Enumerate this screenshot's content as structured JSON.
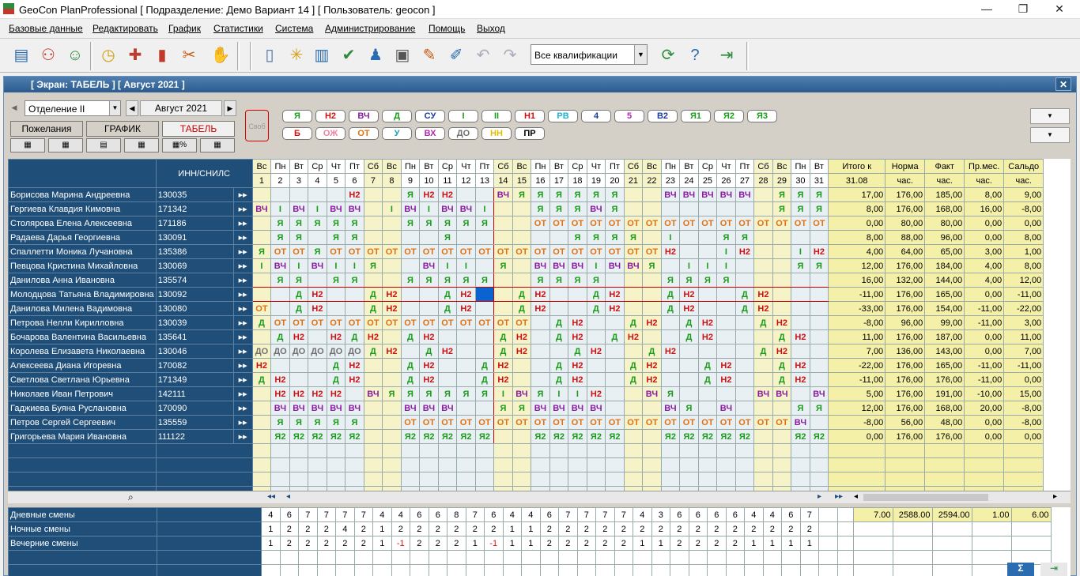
{
  "window": {
    "title": "GeoCon PlanProfessional [ Подразделение: Демо Вариант 14 ] [ Пользователь: geocon ]",
    "min": "—",
    "max": "❐",
    "close": "✕"
  },
  "menu": [
    "Базовые данные",
    "Редактировать",
    "График",
    "Статистики",
    "Система",
    "Администрирование",
    "Помощь",
    "Выход"
  ],
  "toolbar": {
    "qualification": "Все квалификации",
    "icons": [
      "staff-icon",
      "team-icon",
      "user-add-icon",
      "clock-icon",
      "calendar-add-icon",
      "chart-icon",
      "tools-icon",
      "hand-icon",
      "document-icon",
      "wand-icon",
      "trash-icon",
      "check-icon",
      "person-icon",
      "print-icon",
      "wrench-icon",
      "brush-icon",
      "undo-icon",
      "redo-icon",
      "refresh-icon",
      "help-icon",
      "exit-icon"
    ]
  },
  "screen": {
    "title": "[ Экран: ТАБЕЛЬ ] [ Август 2021 ]",
    "close": "✕"
  },
  "filters": {
    "department": "Отделение II",
    "month": "Август 2021"
  },
  "tabs": [
    "Пожелания",
    "ГРАФИК",
    "ТАБЕЛЬ"
  ],
  "legend": {
    "free": "Своб",
    "codes": [
      {
        "c": "Я",
        "col": "#1a9c1a"
      },
      {
        "c": "Н2",
        "col": "#d01010"
      },
      {
        "c": "ВЧ",
        "col": "#8a1aa0"
      },
      {
        "c": "Д",
        "col": "#1a9c1a"
      },
      {
        "c": "СУ",
        "col": "#1a3aa0"
      },
      {
        "c": "I",
        "col": "#1a9c1a"
      },
      {
        "c": "II",
        "col": "#1a9c1a"
      },
      {
        "c": "Н1",
        "col": "#d01010"
      },
      {
        "c": "РВ",
        "col": "#20b0d0"
      },
      {
        "c": "4",
        "col": "#1a3aa0"
      },
      {
        "c": "5",
        "col": "#b02ab0"
      },
      {
        "c": "В2",
        "col": "#1a3aa0"
      },
      {
        "c": "Я1",
        "col": "#1a9c1a"
      },
      {
        "c": "Я2",
        "col": "#1a9c1a"
      },
      {
        "c": "Я3",
        "col": "#1a9c1a"
      },
      {
        "c": "Б",
        "col": "#d01010"
      },
      {
        "c": "ОЖ",
        "col": "#f080a0"
      },
      {
        "c": "ОТ",
        "col": "#e07010"
      },
      {
        "c": "У",
        "col": "#20a0b0"
      },
      {
        "c": "ВХ",
        "col": "#b02ab0"
      },
      {
        "c": "ДО",
        "col": "#707070"
      },
      {
        "c": "НН",
        "col": "#e0c000"
      },
      {
        "c": "ПР",
        "col": "#000000"
      }
    ]
  },
  "colors": {
    "Я": "#1a9c1a",
    "Я2": "#1a9c1a",
    "Н2": "#d01010",
    "ВЧ": "#8a1aa0",
    "Д": "#1a9c1a",
    "I": "#1a9c1a",
    "ОТ": "#e07010",
    "ДО": "#707070"
  },
  "header": {
    "inn": "ИНН/СНИЛС",
    "weekdays": [
      "Вс",
      "Пн",
      "Вт",
      "Ср",
      "Чт",
      "Пт",
      "Сб",
      "Вс",
      "Пн",
      "Вт",
      "Ср",
      "Чт",
      "Пт",
      "Сб",
      "Вс",
      "Пн",
      "Вт",
      "Ср",
      "Чт",
      "Пт",
      "Сб",
      "Вс",
      "Пн",
      "Вт",
      "Ср",
      "Чт",
      "Пт",
      "Сб",
      "Вс",
      "Пн",
      "Вт"
    ],
    "sum_titles": [
      "Итого к",
      "Норма",
      "Факт",
      "Пр.мес.",
      "Сальдо"
    ],
    "sum_sub": [
      "31.08",
      "час.",
      "час.",
      "час.",
      "час."
    ]
  },
  "employees": [
    {
      "name": "Борисова Марина Андреевна",
      "inn": "130035",
      "days": [
        "",
        "",
        "",
        "",
        "",
        "Н2",
        "",
        "",
        "Я",
        "Н2",
        "Н2",
        "",
        "",
        "ВЧ",
        "Я",
        "Я",
        "Я",
        "Я",
        "Я",
        "Я",
        "",
        "",
        "ВЧ",
        "ВЧ",
        "ВЧ",
        "ВЧ",
        "ВЧ",
        "",
        "Я",
        "Я",
        "Я"
      ],
      "total": "17,00",
      "norm": "176,00",
      "fact": "185,00",
      "prev": "8,00",
      "saldo": "9,00"
    },
    {
      "name": "Гергиева Клавдия Кимовна",
      "inn": "171342",
      "days": [
        "ВЧ",
        "I",
        "ВЧ",
        "I",
        "ВЧ",
        "ВЧ",
        "",
        "I",
        "ВЧ",
        "I",
        "ВЧ",
        "ВЧ",
        "I",
        "",
        "",
        "Я",
        "Я",
        "Я",
        "ВЧ",
        "Я",
        "",
        "",
        "",
        "",
        "",
        "",
        "",
        "",
        "Я",
        "Я",
        "Я"
      ],
      "total": "8,00",
      "norm": "176,00",
      "fact": "168,00",
      "prev": "16,00",
      "saldo": "-8,00"
    },
    {
      "name": "Столярова Елена Алексеевна",
      "inn": "171186",
      "days": [
        "",
        "Я",
        "Я",
        "Я",
        "Я",
        "Я",
        "",
        "",
        "Я",
        "Я",
        "Я",
        "Я",
        "Я",
        "",
        "",
        "ОТ",
        "ОТ",
        "ОТ",
        "ОТ",
        "ОТ",
        "ОТ",
        "ОТ",
        "ОТ",
        "ОТ",
        "ОТ",
        "ОТ",
        "ОТ",
        "ОТ",
        "ОТ",
        "ОТ",
        "ОТ"
      ],
      "total": "0,00",
      "norm": "80,00",
      "fact": "80,00",
      "prev": "0,00",
      "saldo": "0,00"
    },
    {
      "name": "Радаева Дарья Георгиевна",
      "inn": "130091",
      "days": [
        "",
        "Я",
        "Я",
        "",
        "Я",
        "Я",
        "",
        "",
        "",
        "",
        "Я",
        "",
        "",
        "",
        "",
        "",
        "",
        "Я",
        "Я",
        "Я",
        "Я",
        "",
        "I",
        "",
        "",
        "Я",
        "Я",
        "",
        "",
        "",
        ""
      ],
      "total": "8,00",
      "norm": "88,00",
      "fact": "96,00",
      "prev": "0,00",
      "saldo": "8,00"
    },
    {
      "name": "Спаллетти Моника Лучановна",
      "inn": "135386",
      "days": [
        "Я",
        "ОТ",
        "ОТ",
        "Я",
        "ОТ",
        "ОТ",
        "ОТ",
        "ОТ",
        "ОТ",
        "ОТ",
        "ОТ",
        "ОТ",
        "ОТ",
        "ОТ",
        "ОТ",
        "ОТ",
        "ОТ",
        "ОТ",
        "ОТ",
        "ОТ",
        "ОТ",
        "ОТ",
        "Н2",
        "",
        "",
        "I",
        "Н2",
        "",
        "",
        "I",
        "Н2"
      ],
      "total": "4,00",
      "norm": "64,00",
      "fact": "65,00",
      "prev": "3,00",
      "saldo": "1,00"
    },
    {
      "name": "Певцова Кристина Михайловна",
      "inn": "130069",
      "days": [
        "I",
        "ВЧ",
        "I",
        "ВЧ",
        "I",
        "I",
        "Я",
        "",
        "",
        "ВЧ",
        "I",
        "I",
        "",
        "Я",
        "",
        "ВЧ",
        "ВЧ",
        "ВЧ",
        "I",
        "ВЧ",
        "ВЧ",
        "Я",
        "",
        "I",
        "I",
        "I",
        "",
        "",
        "",
        "Я",
        "Я"
      ],
      "total": "12,00",
      "norm": "176,00",
      "fact": "184,00",
      "prev": "4,00",
      "saldo": "8,00"
    },
    {
      "name": "Данилова Анна Ивановна",
      "inn": "135574",
      "days": [
        "",
        "Я",
        "Я",
        "",
        "Я",
        "Я",
        "",
        "",
        "Я",
        "Я",
        "Я",
        "Я",
        "Я",
        "",
        "",
        "Я",
        "Я",
        "Я",
        "Я",
        "",
        "",
        "",
        "Я",
        "Я",
        "Я",
        "Я",
        "",
        "",
        "",
        "",
        ""
      ],
      "total": "16,00",
      "norm": "132,00",
      "fact": "144,00",
      "prev": "4,00",
      "saldo": "12,00"
    },
    {
      "name": "Молодцова Татьяна Владимировна",
      "inn": "130092",
      "days": [
        "",
        "",
        "Д",
        "Н2",
        "",
        "",
        "Д",
        "Н2",
        "",
        "",
        "Д",
        "Н2",
        "",
        "",
        "Д",
        "Н2",
        "",
        "",
        "Д",
        "Н2",
        "",
        "",
        "Д",
        "Н2",
        "",
        "",
        "Д",
        "Н2",
        "",
        "",
        ""
      ],
      "total": "-11,00",
      "norm": "176,00",
      "fact": "165,00",
      "prev": "0,00",
      "saldo": "-11,00"
    },
    {
      "name": "Данилова Милена Вадимовна",
      "inn": "130080",
      "days": [
        "ОТ",
        "",
        "Д",
        "Н2",
        "",
        "",
        "Д",
        "Н2",
        "",
        "",
        "Д",
        "Н2",
        "",
        "",
        "Д",
        "Н2",
        "",
        "",
        "Д",
        "Н2",
        "",
        "",
        "Д",
        "Н2",
        "",
        "",
        "Д",
        "Н2",
        "",
        "",
        ""
      ],
      "total": "-33,00",
      "norm": "176,00",
      "fact": "154,00",
      "prev": "-11,00",
      "saldo": "-22,00"
    },
    {
      "name": "Петрова Нелли Кирилловна",
      "inn": "130039",
      "days": [
        "Д",
        "ОТ",
        "ОТ",
        "ОТ",
        "ОТ",
        "ОТ",
        "ОТ",
        "ОТ",
        "ОТ",
        "ОТ",
        "ОТ",
        "ОТ",
        "ОТ",
        "ОТ",
        "ОТ",
        "",
        "Д",
        "Н2",
        "",
        "",
        "Д",
        "Н2",
        "",
        "Д",
        "Н2",
        "",
        "",
        "Д",
        "Н2",
        "",
        ""
      ],
      "total": "-8,00",
      "norm": "96,00",
      "fact": "99,00",
      "prev": "-11,00",
      "saldo": "3,00"
    },
    {
      "name": "Бочарова Валентина Васильевна",
      "inn": "135641",
      "days": [
        "",
        "Д",
        "Н2",
        "",
        "Н2",
        "Д",
        "Н2",
        "",
        "Д",
        "Н2",
        "",
        "",
        "",
        "Д",
        "Н2",
        "",
        "Д",
        "Н2",
        "",
        "Д",
        "Н2",
        "",
        "",
        "Д",
        "Н2",
        "",
        "",
        "",
        "Д",
        "Н2",
        ""
      ],
      "total": "11,00",
      "norm": "176,00",
      "fact": "187,00",
      "prev": "0,00",
      "saldo": "11,00"
    },
    {
      "name": "Королева Елизавета Николаевна",
      "inn": "130046",
      "days": [
        "ДО",
        "ДО",
        "ДО",
        "ДО",
        "ДО",
        "ДО",
        "Д",
        "Н2",
        "",
        "Д",
        "Н2",
        "",
        "",
        "Д",
        "Н2",
        "",
        "",
        "Д",
        "Н2",
        "",
        "",
        "Д",
        "Н2",
        "",
        "",
        "",
        "",
        "Д",
        "Н2",
        "",
        ""
      ],
      "total": "7,00",
      "norm": "136,00",
      "fact": "143,00",
      "prev": "0,00",
      "saldo": "7,00"
    },
    {
      "name": "Алексеева Диана Игоревна",
      "inn": "170082",
      "days": [
        "Н2",
        "",
        "",
        "",
        "Д",
        "Н2",
        "",
        "",
        "Д",
        "Н2",
        "",
        "",
        "Д",
        "Н2",
        "",
        "",
        "Д",
        "Н2",
        "",
        "",
        "Д",
        "Н2",
        "",
        "",
        "Д",
        "Н2",
        "",
        "",
        "Д",
        "Н2",
        ""
      ],
      "total": "-22,00",
      "norm": "176,00",
      "fact": "165,00",
      "prev": "-11,00",
      "saldo": "-11,00"
    },
    {
      "name": "Светлова Светлана Юрьевна",
      "inn": "171349",
      "days": [
        "Д",
        "Н2",
        "",
        "",
        "Д",
        "Н2",
        "",
        "",
        "Д",
        "Н2",
        "",
        "",
        "Д",
        "Н2",
        "",
        "",
        "Д",
        "Н2",
        "",
        "",
        "Д",
        "Н2",
        "",
        "",
        "Д",
        "Н2",
        "",
        "",
        "Д",
        "Н2",
        ""
      ],
      "total": "-11,00",
      "norm": "176,00",
      "fact": "176,00",
      "prev": "-11,00",
      "saldo": "0,00"
    },
    {
      "name": "Николаев Иван Петрович",
      "inn": "142111",
      "days": [
        "",
        "Н2",
        "Н2",
        "Н2",
        "Н2",
        "",
        "ВЧ",
        "Я",
        "Я",
        "Я",
        "Я",
        "Я",
        "Я",
        "I",
        "ВЧ",
        "Я",
        "I",
        "I",
        "Н2",
        "",
        "",
        "ВЧ",
        "Я",
        "",
        "",
        "",
        "",
        "ВЧ",
        "ВЧ",
        "",
        "ВЧ"
      ],
      "total": "5,00",
      "norm": "176,00",
      "fact": "191,00",
      "prev": "-10,00",
      "saldo": "15,00"
    },
    {
      "name": "Гаджиева Буяна Руслановна",
      "inn": "170090",
      "days": [
        "",
        "ВЧ",
        "ВЧ",
        "ВЧ",
        "ВЧ",
        "ВЧ",
        "",
        "",
        "ВЧ",
        "ВЧ",
        "ВЧ",
        "",
        "",
        "Я",
        "Я",
        "ВЧ",
        "ВЧ",
        "ВЧ",
        "ВЧ",
        "",
        "",
        "",
        "ВЧ",
        "Я",
        "",
        "ВЧ",
        "",
        "",
        "",
        "Я",
        "Я"
      ],
      "total": "12,00",
      "norm": "176,00",
      "fact": "168,00",
      "prev": "20,00",
      "saldo": "-8,00"
    },
    {
      "name": "Петров Сергей Сергеевич",
      "inn": "135559",
      "days": [
        "",
        "Я",
        "Я",
        "Я",
        "Я",
        "Я",
        "",
        "",
        "ОТ",
        "ОТ",
        "ОТ",
        "ОТ",
        "ОТ",
        "ОТ",
        "ОТ",
        "ОТ",
        "ОТ",
        "ОТ",
        "ОТ",
        "ОТ",
        "ОТ",
        "ОТ",
        "ОТ",
        "ОТ",
        "ОТ",
        "ОТ",
        "ОТ",
        "ОТ",
        "ОТ",
        "ВЧ",
        ""
      ],
      "total": "-8,00",
      "norm": "56,00",
      "fact": "48,00",
      "prev": "0,00",
      "saldo": "-8,00"
    },
    {
      "name": "Григорьева Мария Ивановна",
      "inn": "111122",
      "days": [
        "",
        "Я2",
        "Я2",
        "Я2",
        "Я2",
        "Я2",
        "",
        "",
        "Я2",
        "Я2",
        "Я2",
        "Я2",
        "Я2",
        "",
        "",
        "Я2",
        "Я2",
        "Я2",
        "Я2",
        "Я2",
        "",
        "",
        "Я2",
        "Я2",
        "Я2",
        "Я2",
        "Я2",
        "",
        "",
        "Я2",
        "Я2"
      ],
      "total": "0,00",
      "norm": "176,00",
      "fact": "176,00",
      "prev": "0,00",
      "saldo": "0,00"
    }
  ],
  "bottom": {
    "rows": [
      {
        "label": "Дневные смены",
        "vals": [
          "4",
          "6",
          "7",
          "7",
          "7",
          "7",
          "4",
          "4",
          "6",
          "6",
          "8",
          "7",
          "6",
          "4",
          "4",
          "6",
          "7",
          "7",
          "7",
          "7",
          "4",
          "3",
          "6",
          "6",
          "6",
          "6",
          "4",
          "4",
          "6",
          "7",
          ""
        ]
      },
      {
        "label": "Ночные смены",
        "vals": [
          "1",
          "2",
          "2",
          "2",
          "4",
          "2",
          "1",
          "2",
          "2",
          "2",
          "2",
          "2",
          "2",
          "1",
          "1",
          "2",
          "2",
          "2",
          "2",
          "2",
          "2",
          "2",
          "2",
          "2",
          "2",
          "2",
          "2",
          "2",
          "2",
          "2",
          ""
        ]
      },
      {
        "label": "Вечерние смены",
        "vals": [
          "1",
          "2",
          "2",
          "2",
          "2",
          "2",
          "1",
          "-1",
          "2",
          "2",
          "2",
          "1",
          "-1",
          "1",
          "1",
          "2",
          "2",
          "2",
          "2",
          "2",
          "1",
          "1",
          "2",
          "2",
          "2",
          "2",
          "1",
          "1",
          "1",
          "1",
          ""
        ]
      }
    ],
    "totals": [
      "7.00",
      "2588.00",
      "2594.00",
      "1.00",
      "6.00"
    ]
  }
}
